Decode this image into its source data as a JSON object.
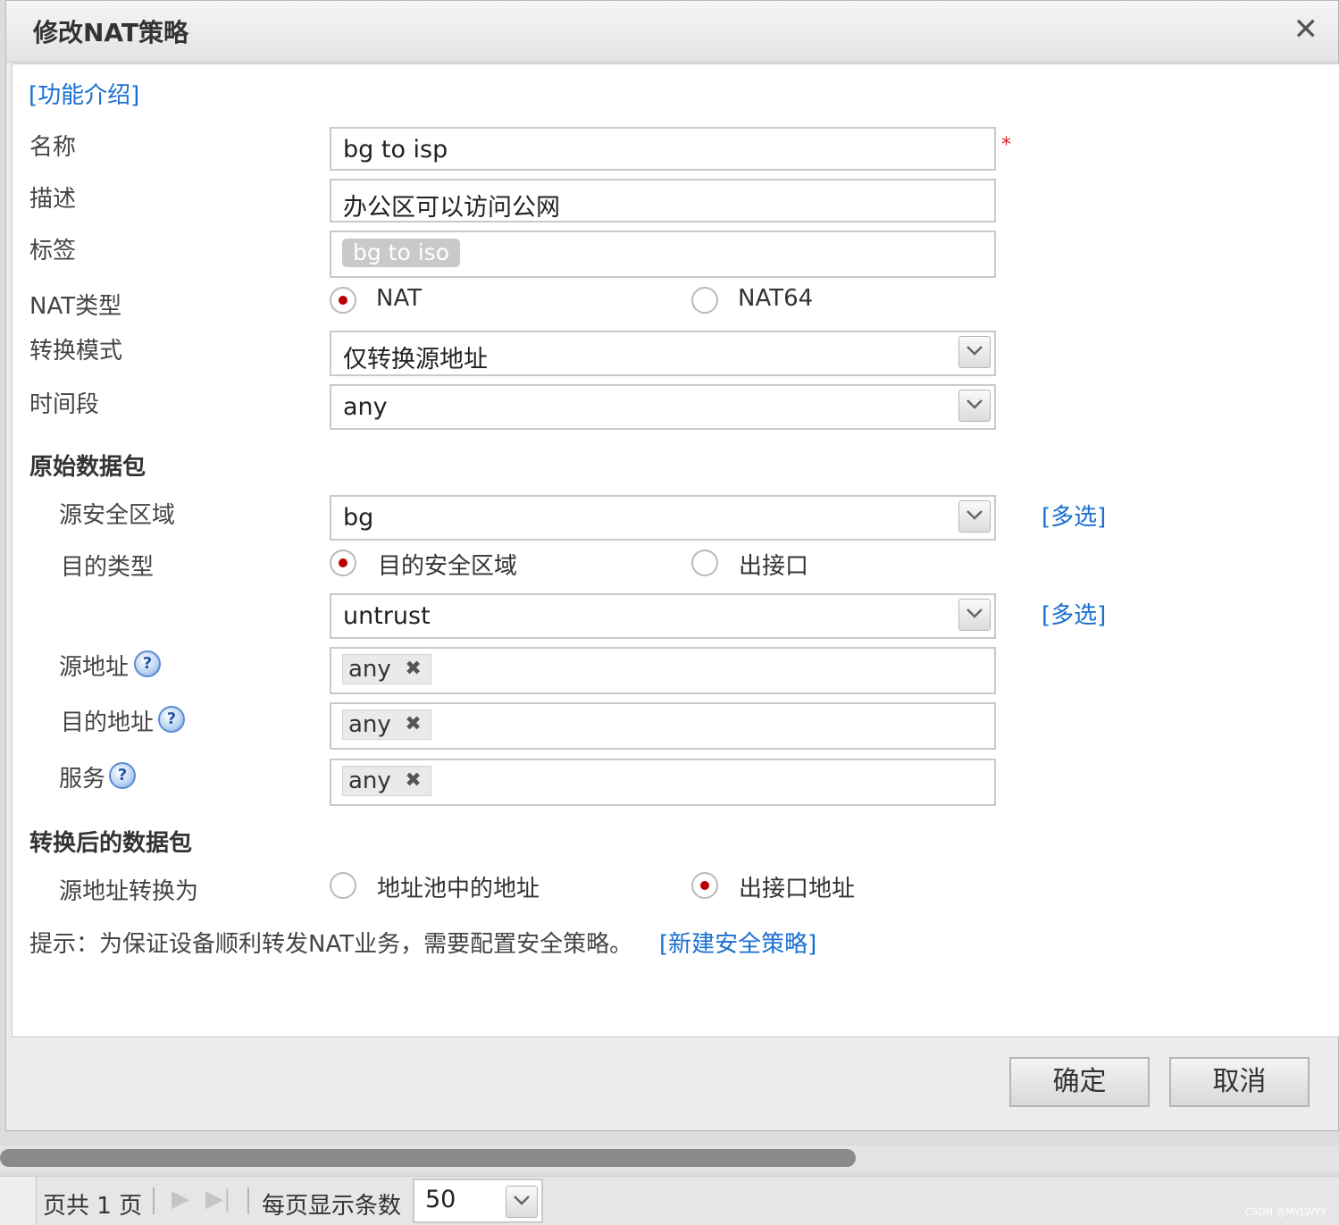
{
  "dialog": {
    "title": "修改NAT策略",
    "close_symbol": "✕",
    "intro_link": "[功能介绍]",
    "name": {
      "label": "名称",
      "value": "bg to isp",
      "required_mark": "*"
    },
    "description": {
      "label": "描述",
      "value": "办公区可以访问公网"
    },
    "tag": {
      "label": "标签",
      "value": "bg to iso"
    },
    "nat_type": {
      "label": "NAT类型",
      "options": [
        {
          "label": "NAT",
          "selected": true
        },
        {
          "label": "NAT64",
          "selected": false
        }
      ]
    },
    "convert_mode": {
      "label": "转换模式",
      "value": "仅转换源地址"
    },
    "time_range": {
      "label": "时间段",
      "value": "any"
    },
    "original_packet": {
      "heading": "原始数据包",
      "source_zone": {
        "label": "源安全区域",
        "value": "bg",
        "multi_link": "[多选]"
      },
      "dest_type": {
        "label": "目的类型",
        "options": [
          {
            "label": "目的安全区域",
            "selected": true
          },
          {
            "label": "出接口",
            "selected": false
          }
        ]
      },
      "dest_zone": {
        "value": "untrust",
        "multi_link": "[多选]"
      },
      "source_address": {
        "label": "源地址",
        "tag": "any"
      },
      "dest_address": {
        "label": "目的地址",
        "tag": "any"
      },
      "service": {
        "label": "服务",
        "tag": "any"
      }
    },
    "translated_packet": {
      "heading": "转换后的数据包",
      "source_convert": {
        "label": "源地址转换为",
        "options": [
          {
            "label": "地址池中的地址",
            "selected": false
          },
          {
            "label": "出接口地址",
            "selected": true
          }
        ]
      }
    },
    "hint": {
      "text": "提示：为保证设备顺利转发NAT业务，需要配置安全策略。",
      "link": "[新建安全策略]"
    },
    "buttons": {
      "ok": "确定",
      "cancel": "取消"
    }
  },
  "pager": {
    "page_text": "页共 1 页",
    "page_size_label": "每页显示条数",
    "page_size": "50"
  },
  "watermark": "CSDN @MYLWYY",
  "help_symbol": "?",
  "tag_remove_symbol": "✖",
  "colors": {
    "link": "#1a6fd0",
    "radio_selected": "#b80000",
    "required": "#e02020"
  }
}
